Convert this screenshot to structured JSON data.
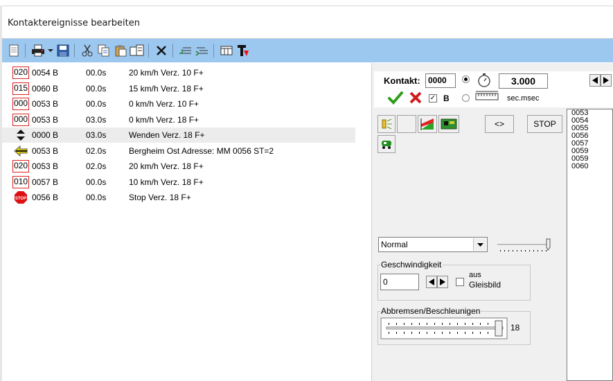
{
  "window": {
    "title": "Kontaktereignisse bearbeiten"
  },
  "toolbar": {
    "icons": [
      "new-document-icon",
      "print-icon",
      "dropdown-arrow-icon",
      "save-icon",
      "cut-icon",
      "copy-icon",
      "paste-icon",
      "paste-special-icon",
      "delete-icon",
      "insert-line-icon",
      "move-line-icon",
      "table-view-icon",
      "text-format-icon"
    ]
  },
  "events": [
    {
      "kind": "speed",
      "speed": "020",
      "contact": "0054 B",
      "time": "00.0s",
      "desc": "20 km/h Verz. 10 F+"
    },
    {
      "kind": "speed",
      "speed": "015",
      "contact": "0060 B",
      "time": "00.0s",
      "desc": "15 km/h Verz. 18 F+"
    },
    {
      "kind": "speed",
      "speed": "000",
      "contact": "0053 B",
      "time": "00.0s",
      "desc": "0 km/h Verz. 10 F+"
    },
    {
      "kind": "speed",
      "speed": "000",
      "contact": "0053 B",
      "time": "03.0s",
      "desc": "0 km/h Verz. 18 F+"
    },
    {
      "kind": "reverse",
      "contact": "0000 B",
      "time": "03.0s",
      "desc": "Wenden Verz. 18 F+",
      "selected": true
    },
    {
      "kind": "address",
      "contact": "0053 B",
      "time": "02.0s",
      "desc": "Bergheim Ost Adresse: MM 0056 ST=2"
    },
    {
      "kind": "speed",
      "speed": "020",
      "contact": "0053 B",
      "time": "02.0s",
      "desc": "20 km/h Verz. 18 F+"
    },
    {
      "kind": "speed",
      "speed": "010",
      "contact": "0057 B",
      "time": "00.0s",
      "desc": "10 km/h Verz. 18 F+"
    },
    {
      "kind": "stop",
      "icon_text": "STOP",
      "contact": "0056 B",
      "time": "00.0s",
      "desc": "Stop Verz. 18 F+"
    }
  ],
  "kontakt": {
    "label": "Kontakt:",
    "value": "0000",
    "b_label": "B",
    "b_checked": true,
    "time_value": "3.000",
    "time_unit": "sec.msec",
    "timer_radio_selected": true
  },
  "actions": {
    "swap_label": "<>",
    "stop_label": "STOP"
  },
  "contact_list": [
    "0053",
    "0054",
    "0055",
    "0056",
    "0057",
    "0059",
    "0059",
    "0060"
  ],
  "mode": {
    "selected": "Normal"
  },
  "speed": {
    "legend": "Geschwindigkeit",
    "value": "0",
    "aus_label": "aus",
    "gleisbild_label": "Gleisbild"
  },
  "brake": {
    "legend": "Abbremsen/Beschleunigen",
    "value": "18"
  },
  "colors": {
    "toolbar_bg": "#9cc7ef",
    "speed_box_border": "#e02020",
    "check_green": "#2e9e1a",
    "cross_red": "#d21a1a"
  }
}
